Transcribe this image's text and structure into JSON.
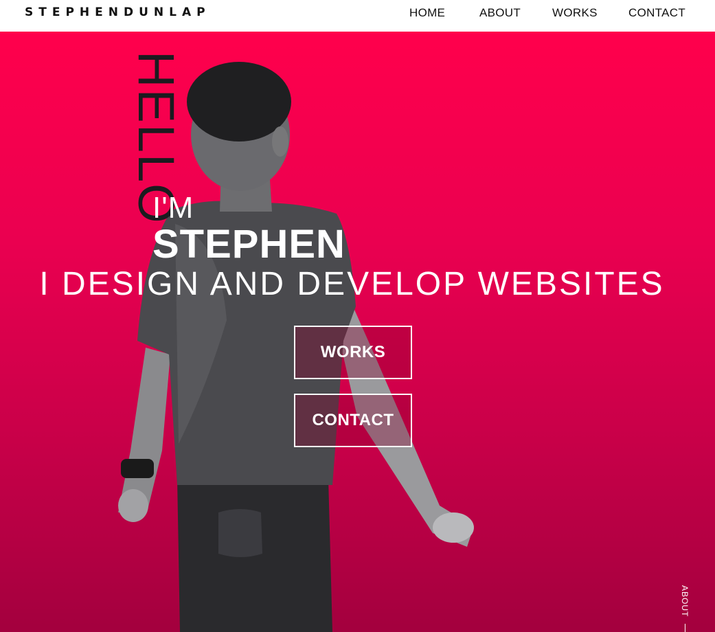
{
  "nav": {
    "logo": "STEPHENDUNLAP",
    "links": [
      "HOME",
      "ABOUT",
      "WORKS",
      "CONTACT"
    ]
  },
  "hero": {
    "hello": "HELLO",
    "intro": "I'M",
    "name": "STEPHEN",
    "tagline": "I DESIGN AND DEVELOP WEBSITES",
    "buttons": [
      "WORKS",
      "CONTACT"
    ],
    "side_link": "ABOUT"
  },
  "colors": {
    "accent": "#ff004c",
    "accent_dark": "#a3003e",
    "text_light": "#ffffff",
    "text_dark": "#111111"
  }
}
